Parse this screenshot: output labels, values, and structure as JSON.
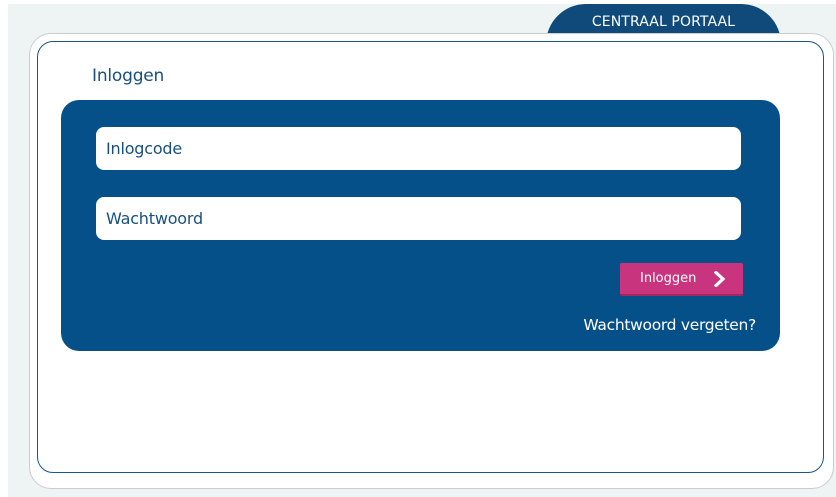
{
  "header": {
    "portal_tab_label": "CENTRAAL PORTAAL"
  },
  "login": {
    "title": "Inloggen",
    "username_placeholder": "Inlogcode",
    "password_placeholder": "Wachtwoord",
    "submit_label": "Inloggen",
    "submit_icon": "chevron-right-icon",
    "forgot_password_label": "Wachtwoord vergeten?"
  },
  "colors": {
    "brand_blue": "#06508a",
    "accent_pink": "#c9347f",
    "background": "#eef4f4"
  }
}
